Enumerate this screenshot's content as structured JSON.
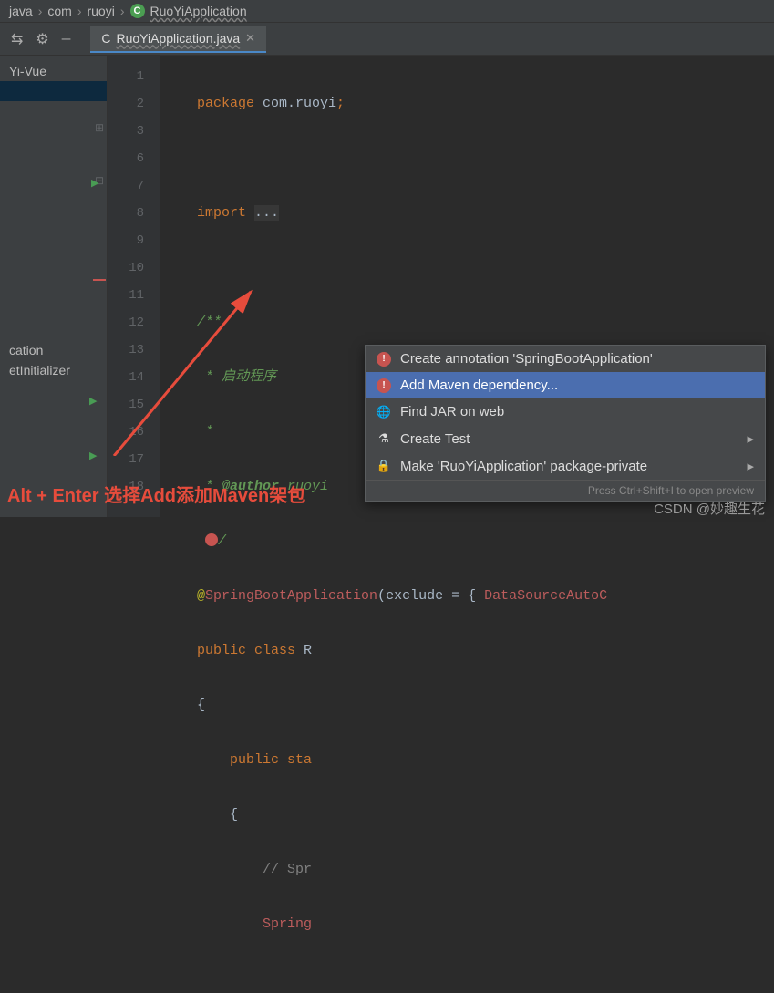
{
  "breadcrumb": {
    "parts": [
      "java",
      "com",
      "ruoyi",
      "RuoYiApplication"
    ]
  },
  "tab": {
    "name": "RuoYiApplication.java"
  },
  "sidebar": {
    "top_item": "Yi-Vue",
    "bottom_items": [
      "cation",
      "etInitializer"
    ]
  },
  "gutter": {
    "lines": [
      "1",
      "2",
      "3",
      "6",
      "7",
      "8",
      "9",
      "10",
      "11",
      "12",
      "13",
      "14",
      "15",
      "16",
      "17",
      "18"
    ]
  },
  "code": {
    "l1_package": "package ",
    "l1_pkg": "com.ruoyi",
    "l1_semi": ";",
    "l3_import": "import ",
    "l3_dots": "...",
    "l7_docstart": "/**",
    "l8_star": " * ",
    "l8_txt": "启动程序",
    "l9_star": " *",
    "l10_star": " * ",
    "l10_tag": "@author",
    "l10_val": " ruoyi",
    "l11_slash": "/",
    "l12_at": "@",
    "l12_ann": "SpringBootApplication",
    "l12_paren": "(",
    "l12_attr": "exclude ",
    "l12_eq": "= { ",
    "l12_val": "DataSourceAutoC",
    "l13_pub": "pu",
    "l13_blic": "blic ",
    "l13_class": "class ",
    "l13_R": "R",
    "l14_brace": "{",
    "l15_pubsta": "public sta",
    "l16_brace": "{",
    "l17_comment": "// Spr",
    "l18_spring": "Spring"
  },
  "menu": {
    "items": [
      {
        "label": "Create annotation 'SpringBootApplication'",
        "icon": "ic-red"
      },
      {
        "label": "Add Maven dependency...",
        "icon": "ic-red",
        "selected": true
      },
      {
        "label": "Find JAR on web",
        "icon": "ic-globe"
      },
      {
        "label": "Create Test",
        "icon": "",
        "arrow": true
      },
      {
        "label": "Make 'RuoYiApplication' package-private",
        "icon": "",
        "arrow": true
      }
    ],
    "footer": "Press Ctrl+Shift+I to open preview"
  },
  "annotation": "Alt + Enter 选择Add添加Maven架包",
  "watermark": "CSDN @妙趣生花"
}
